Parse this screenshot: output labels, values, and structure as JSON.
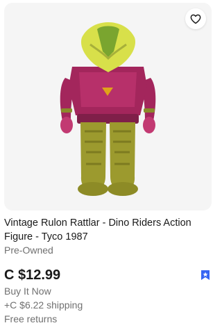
{
  "listing": {
    "title": "Vintage Rulon Rattlar - Dino Riders Action Figure - Tyco 1987",
    "condition": "Pre-Owned",
    "price": "C $12.99",
    "format": "Buy It Now",
    "shipping": "+C $6.22 shipping",
    "returns": "Free returns",
    "image_alt": "Vintage Rulon Rattlar action figure"
  },
  "icons": {
    "watch": "heart-icon",
    "badge": "bookmark-star-icon"
  },
  "colors": {
    "image_background": "#f5f5f5",
    "figure_head": "#d8e04a",
    "figure_body": "#a3265c",
    "figure_legs": "#9c9a2e",
    "badge": "#3665f3"
  }
}
